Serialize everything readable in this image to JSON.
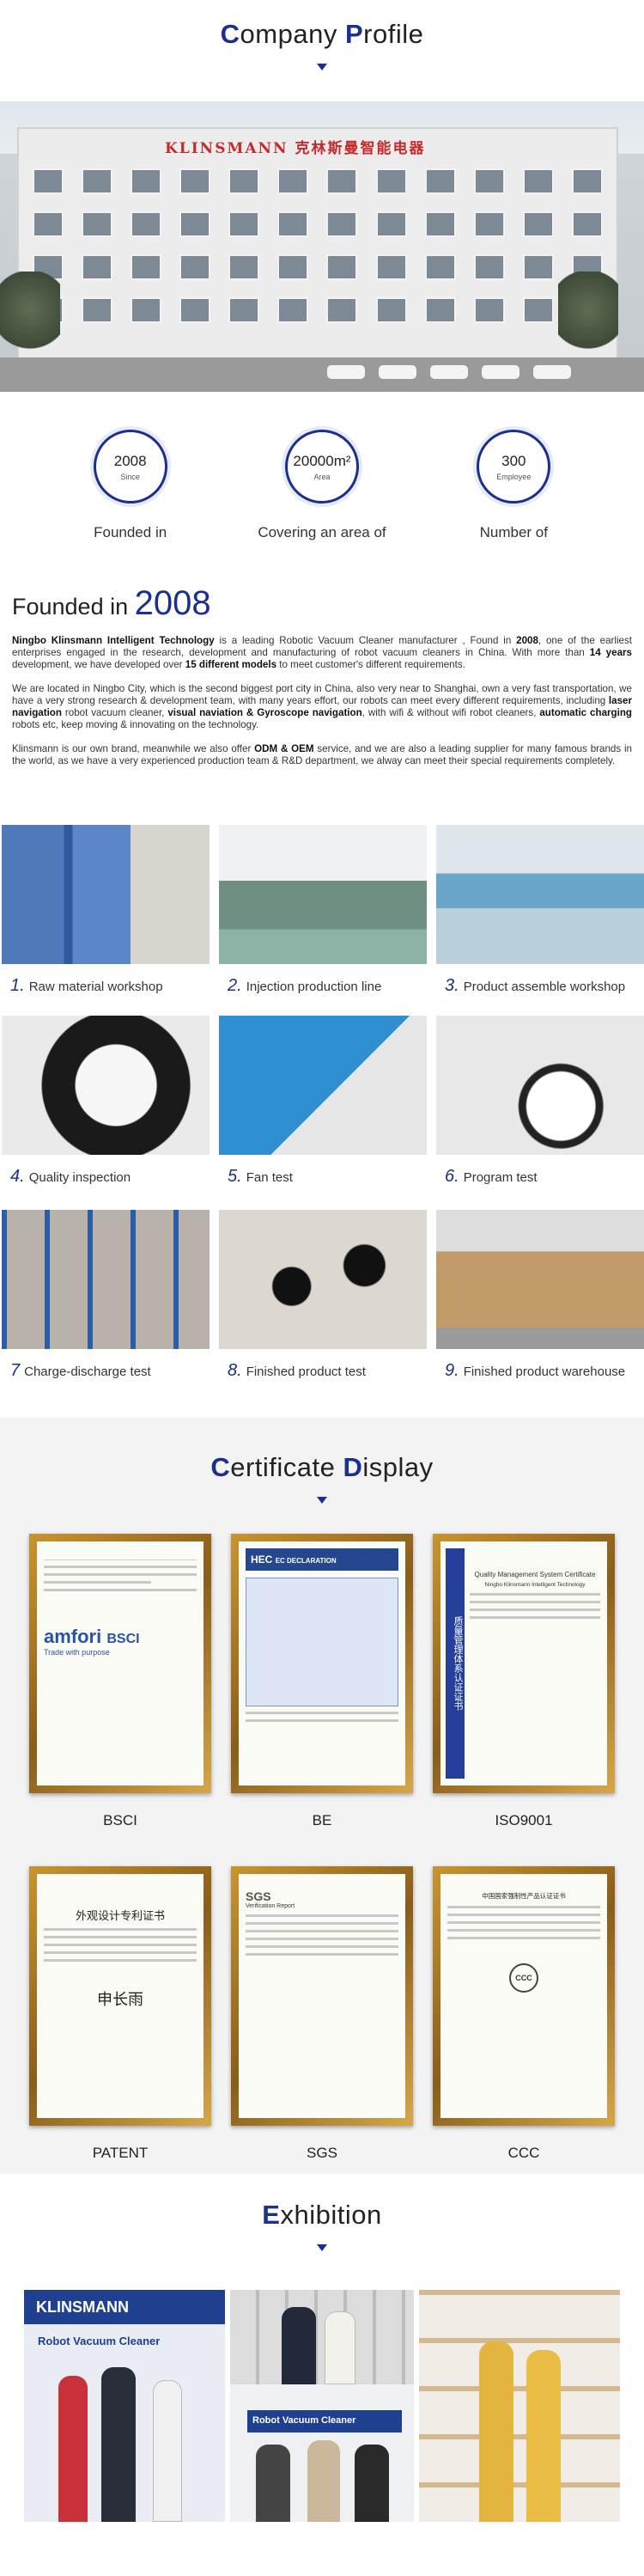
{
  "profile": {
    "title_first": "C",
    "title_rest": "ompany ",
    "title_first2": "P",
    "title_rest2": "rofile",
    "sign": "KLINSMANN 克林斯曼智能电器"
  },
  "stats": [
    {
      "num": "2008",
      "unit": "Since",
      "caption": "Founded in"
    },
    {
      "num": "20000m²",
      "unit": "Area",
      "caption": "Covering an area of"
    },
    {
      "num": "300",
      "unit": "Employee",
      "caption": "Number of"
    }
  ],
  "founded": {
    "label": "Founded in ",
    "year": "2008",
    "p1_company": "Ningbo Klinsmann Intelligent Technology",
    "p1_a": " is a leading Robotic Vacuum Cleaner manufacturer , Found in ",
    "p1_year": "2008",
    "p1_b": ", one of the earliest enterprises engaged in the research, development and manufacturing of robot vacuum cleaners in China. With more than ",
    "p1_years": "14 years",
    "p1_c": " development, we have developed over ",
    "p1_models": "15 different models",
    "p1_d": " to meet customer's different requirements.",
    "p2_a": "We are located in Ningbo City, which is the second biggest port city in China, also very near to Shanghai, own a very fast transportation, we have a very strong research & development team, with many years effort, our robots can meet every different requirements, including ",
    "p2_laser": "laser navigation",
    "p2_b": " robot vacuum cleaner, ",
    "p2_visual": "visual naviation & Gyroscope navigation",
    "p2_c": ", with wifi & without wifi robot cleaners, ",
    "p2_auto": "automatic charging",
    "p2_d": " robots etc, keep moving & innovating on the technology.",
    "p3_a": "Klinsmann is our own brand, meanwhile we also offer ",
    "p3_odm": "ODM & OEM",
    "p3_b": " service, and we are also a leading supplier for many famous brands in the world, as we have a very experienced production team & R&D department, we alway can meet their special requirements completely."
  },
  "gallery": [
    {
      "n": "1.",
      "label": "Raw material workshop"
    },
    {
      "n": "2.",
      "label": "Injection production line"
    },
    {
      "n": "3.",
      "label": "Product assemble workshop"
    },
    {
      "n": "4.",
      "label": "Quality inspection"
    },
    {
      "n": "5.",
      "label": "Fan test"
    },
    {
      "n": "6.",
      "label": "Program test"
    },
    {
      "n": "7",
      "label": "Charge-discharge test"
    },
    {
      "n": "8.",
      "label": "Finished product test"
    },
    {
      "n": "9.",
      "label": "Finished product warehouse"
    }
  ],
  "certificates": {
    "title_first": "C",
    "title_rest": "ertificate ",
    "title_first2": "D",
    "title_rest2": "isplay",
    "items": [
      {
        "name": "BSCI",
        "brand": "amfori",
        "brand2": "BSCI",
        "tag": "Trade with purpose"
      },
      {
        "name": "BE",
        "brand": "HEC",
        "brand2": "EC DECLARATION"
      },
      {
        "name": "ISO9001",
        "brand": "Quality Management System Certificate",
        "brand2": "Ningbo Klinsmann Intelligent Technology",
        "side": "质量管理体系认证证书"
      },
      {
        "name": "PATENT",
        "brand": "外观设计专利证书",
        "sign": "申长雨"
      },
      {
        "name": "SGS",
        "brand": "SGS",
        "brand2": "Verification Report"
      },
      {
        "name": "CCC",
        "brand": "中国国家强制性产品认证证书",
        "logo": "CCC"
      }
    ]
  },
  "exhibition": {
    "title_first": "E",
    "title_rest": "xhibition",
    "banner": "KLINSMANN",
    "banner2": "Robot Vacuum Cleaner",
    "banner3": "Robot Vacuum Cleaner"
  },
  "colors": {
    "accent": "#1a2f8f",
    "frame": "#b07f2a"
  }
}
